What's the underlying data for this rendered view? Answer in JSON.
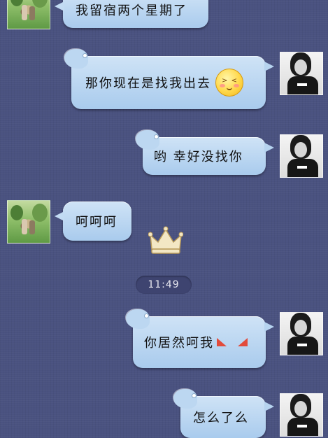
{
  "conversation": {
    "messages": [
      {
        "sender": "friend",
        "text": "我留宿两个星期了"
      },
      {
        "sender": "me",
        "text": "那你现在是找我出去",
        "emoji": "embarrassed-face-icon"
      },
      {
        "sender": "me",
        "text": "哟 幸好没找你"
      },
      {
        "sender": "friend",
        "text": "呵呵呵"
      },
      {
        "sender": "me",
        "text": "你居然呵我",
        "emoji": "red-flag-icons"
      },
      {
        "sender": "me",
        "text": "怎么了么"
      }
    ],
    "timestamp": "11:49",
    "sticker": "crown-icon"
  },
  "colors": {
    "background": "#4a5280",
    "bubble": "#bcd7f1",
    "timestamp_pill": "#3e4470"
  }
}
